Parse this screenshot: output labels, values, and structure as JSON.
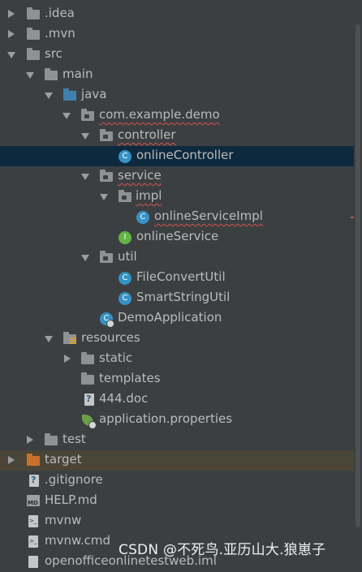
{
  "project_tree": {
    "items": [
      {
        "label": ".idea",
        "arrow": "right",
        "icon": "folder-icon"
      },
      {
        "label": ".mvn",
        "arrow": "right",
        "icon": "folder-icon"
      },
      {
        "label": "src",
        "arrow": "down",
        "icon": "folder-icon"
      },
      {
        "label": "main",
        "arrow": "down",
        "icon": "folder-icon"
      },
      {
        "label": "java",
        "arrow": "down",
        "icon": "source-folder-icon"
      },
      {
        "label": "com.example.demo",
        "arrow": "down",
        "icon": "package-icon"
      },
      {
        "label": "controller",
        "arrow": "down",
        "icon": "package-icon"
      },
      {
        "label": "onlineController",
        "arrow": "none",
        "icon": "class-icon",
        "selected": true
      },
      {
        "label": "service",
        "arrow": "down",
        "icon": "package-icon"
      },
      {
        "label": "impl",
        "arrow": "down",
        "icon": "package-icon"
      },
      {
        "label": "onlineServiceImpl",
        "arrow": "none",
        "icon": "class-icon"
      },
      {
        "label": "onlineService",
        "arrow": "none",
        "icon": "interface-icon"
      },
      {
        "label": "util",
        "arrow": "down",
        "icon": "package-icon"
      },
      {
        "label": "FileConvertUtil",
        "arrow": "none",
        "icon": "class-icon"
      },
      {
        "label": "SmartStringUtil",
        "arrow": "none",
        "icon": "class-icon"
      },
      {
        "label": "DemoApplication",
        "arrow": "none",
        "icon": "spring-boot-class-icon"
      },
      {
        "label": "resources",
        "arrow": "down",
        "icon": "resources-folder-icon"
      },
      {
        "label": "static",
        "arrow": "right",
        "icon": "folder-icon"
      },
      {
        "label": "templates",
        "arrow": "none",
        "icon": "folder-icon"
      },
      {
        "label": "444.doc",
        "arrow": "none",
        "icon": "unknown-file-icon"
      },
      {
        "label": "application.properties",
        "arrow": "none",
        "icon": "spring-properties-icon"
      },
      {
        "label": "test",
        "arrow": "right",
        "icon": "folder-icon"
      },
      {
        "label": "target",
        "arrow": "right",
        "icon": "excluded-folder-icon"
      },
      {
        "label": ".gitignore",
        "arrow": "none",
        "icon": "unknown-file-icon"
      },
      {
        "label": "HELP.md",
        "arrow": "none",
        "icon": "markdown-file-icon"
      },
      {
        "label": "mvnw",
        "arrow": "none",
        "icon": "shell-file-icon"
      },
      {
        "label": "mvnw.cmd",
        "arrow": "none",
        "icon": "shell-file-icon"
      },
      {
        "label": "openofficeonlinetestweb.iml",
        "arrow": "none",
        "icon": "module-file-icon"
      }
    ]
  },
  "watermark": {
    "text": "CSDN @不死鸟.亚历山大.狼崽子"
  },
  "colors": {
    "background": "#3c3f41",
    "selection": "#0d293e",
    "excluded_row": "#4a4537",
    "text": "#bbbbbb",
    "error_underline": "#d25252"
  }
}
